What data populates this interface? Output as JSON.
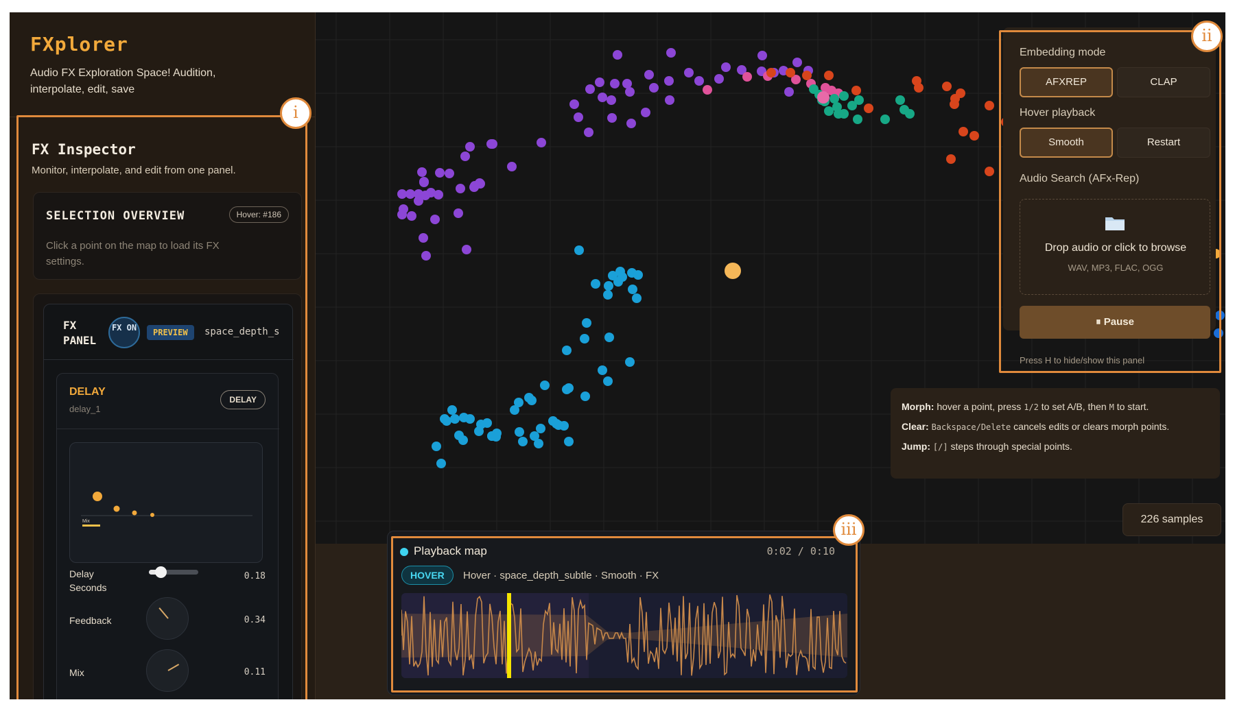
{
  "app": {
    "title": "FXplorer",
    "subtitle": "Audio FX Exploration Space! Audition, interpolate, edit, save"
  },
  "inspector": {
    "title": "FX Inspector",
    "subtitle": "Monitor, interpolate, and edit from one panel."
  },
  "overview": {
    "title": "SELECTION OVERVIEW",
    "badge": "Hover: #186",
    "text": "Click a point on the map to load its FX settings."
  },
  "fx_panel": {
    "label": "FX PANEL",
    "status": "FX ON",
    "preview": "PREVIEW",
    "name": "space_depth_subtle"
  },
  "delay": {
    "title": "DELAY",
    "id": "delay_1",
    "badge": "DELAY",
    "mix_tag": "Mix",
    "params": [
      {
        "label": "Delay Seconds",
        "value": "0.18"
      },
      {
        "label": "Feedback",
        "value": "0.34"
      },
      {
        "label": "Mix",
        "value": "0.11"
      }
    ]
  },
  "controls": {
    "embedding_label": "Embedding mode",
    "embedding_options": [
      "AFXREP",
      "CLAP"
    ],
    "embedding_active": "AFXREP",
    "playback_label": "Hover playback",
    "playback_options": [
      "Smooth",
      "Restart"
    ],
    "playback_active": "Smooth",
    "search_label": "Audio Search (AFx-Rep)",
    "drop_text": "Drop audio or click to browse",
    "drop_formats": "WAV, MP3, FLAC, OGG",
    "pause_label": "⏸ Pause",
    "hint": "Press H to hide/show this panel"
  },
  "help": {
    "morph_label": "Morph:",
    "morph_a": "hover a point, press",
    "morph_keys": "1/2",
    "morph_b": "to set A/B, then",
    "morph_key2": "M",
    "morph_c": "to start.",
    "clear_label": "Clear:",
    "clear_keys": "Backspace/Delete",
    "clear_text": "cancels edits or clears morph points.",
    "jump_label": "Jump:",
    "jump_keys": "[/]",
    "jump_text": "steps through special points."
  },
  "samples": "226 samples",
  "playback": {
    "title": "Playback map",
    "time": "0:02 / 0:10",
    "progress": 0.2,
    "state": "HOVER",
    "desc": "Hover · space_depth_subtle · Smooth · FX"
  },
  "annotations": [
    "i",
    "ii",
    "iii"
  ],
  "colors": {
    "accent": "#f2a93b",
    "purple": "#8c46d6",
    "blue": "#1aa0d8",
    "green": "#17a886",
    "red": "#d8451c",
    "pink": "#e0529a",
    "highlight": "#f5b758",
    "annotation": "#e08a3c"
  },
  "icons": [
    "folder-icon",
    "pause-icon"
  ]
}
